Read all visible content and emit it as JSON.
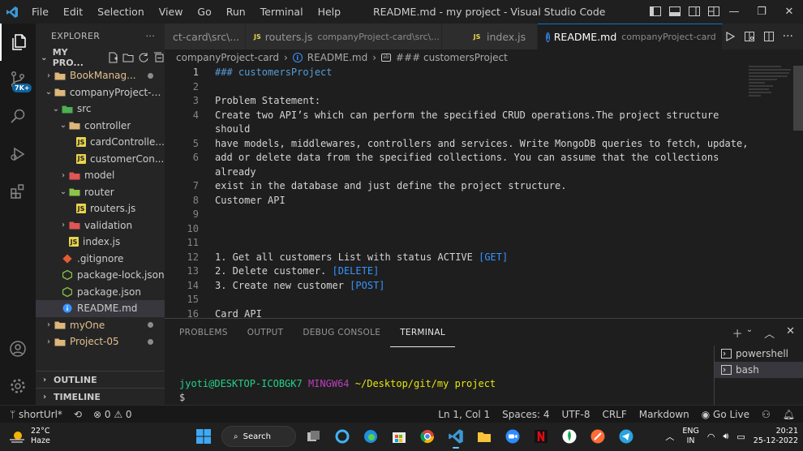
{
  "titlebar": {
    "menus": [
      "File",
      "Edit",
      "Selection",
      "View",
      "Go",
      "Run",
      "Terminal",
      "Help"
    ],
    "title": "README.md - my project - Visual Studio Code"
  },
  "activitybar": {
    "badge": "7K+"
  },
  "sidebar": {
    "header": "EXPLORER",
    "section_title": "MY PRO...",
    "tree": [
      {
        "name": "BookManag...",
        "depth": 1,
        "type": "folder",
        "open": false,
        "color": "#e2c08d",
        "dot": true
      },
      {
        "name": "companyProject-c...",
        "depth": 1,
        "type": "folder",
        "open": true,
        "color": "#cccccc",
        "dot": false
      },
      {
        "name": "src",
        "depth": 2,
        "type": "folder",
        "open": true,
        "color": "#cccccc",
        "dot": false
      },
      {
        "name": "controller",
        "depth": 3,
        "type": "folder",
        "open": true,
        "color": "#cccccc",
        "dot": false
      },
      {
        "name": "cardControlle...",
        "depth": 4,
        "type": "js",
        "color": "#cccccc",
        "dot": false
      },
      {
        "name": "customerCon...",
        "depth": 4,
        "type": "js",
        "color": "#cccccc",
        "dot": false
      },
      {
        "name": "model",
        "depth": 3,
        "type": "folder",
        "open": false,
        "color": "#cccccc",
        "dot": false
      },
      {
        "name": "router",
        "depth": 3,
        "type": "folder",
        "open": true,
        "color": "#cccccc",
        "dot": false
      },
      {
        "name": "routers.js",
        "depth": 4,
        "type": "js",
        "color": "#cccccc",
        "dot": false
      },
      {
        "name": "validation",
        "depth": 3,
        "type": "folder",
        "open": false,
        "color": "#cccccc",
        "dot": false
      },
      {
        "name": "index.js",
        "depth": 3,
        "type": "js",
        "color": "#cccccc",
        "dot": false
      },
      {
        "name": ".gitignore",
        "depth": 2,
        "type": "git",
        "color": "#cccccc",
        "dot": false
      },
      {
        "name": "package-lock.json",
        "depth": 2,
        "type": "json",
        "color": "#cccccc",
        "dot": false
      },
      {
        "name": "package.json",
        "depth": 2,
        "type": "json",
        "color": "#cccccc",
        "dot": false
      },
      {
        "name": "README.md",
        "depth": 2,
        "type": "info",
        "color": "#cccccc",
        "dot": false,
        "selected": true
      },
      {
        "name": "myOne",
        "depth": 1,
        "type": "folder",
        "open": false,
        "color": "#e2c08d",
        "dot": true
      },
      {
        "name": "Project-05",
        "depth": 1,
        "type": "folder",
        "open": false,
        "color": "#e2c08d",
        "dot": true
      }
    ],
    "outline": "OUTLINE",
    "timeline": "TIMELINE"
  },
  "tabs": [
    {
      "label": "ct-card\\src\\...",
      "desc": "",
      "icon": "",
      "active": false
    },
    {
      "label": "routers.js",
      "desc": "companyProject-card\\src\\...",
      "icon": "JS",
      "active": false
    },
    {
      "label": "index.js",
      "desc": "",
      "icon": "JS",
      "active": false
    },
    {
      "label": "README.md",
      "desc": "companyProject-card",
      "icon": "i",
      "active": true
    }
  ],
  "breadcrumb": {
    "folder": "companyProject-card",
    "file": "README.md",
    "symbol": "### customersProject"
  },
  "editor": {
    "lines": [
      {
        "n": "1",
        "text": "### customersProject",
        "kind": "heading"
      },
      {
        "n": "2",
        "text": "",
        "kind": ""
      },
      {
        "n": "3",
        "text": "Problem Statement:",
        "kind": ""
      },
      {
        "n": "4",
        "text": "Create two API’s which can perform the specified CRUD operations.The project structure",
        "kind": ""
      },
      {
        "n": "",
        "text": "should",
        "kind": ""
      },
      {
        "n": "5",
        "text": "have models, middlewares, controllers and services. Write MongoDB queries to fetch, update,",
        "kind": ""
      },
      {
        "n": "6",
        "text": "add or delete data from the specified collections. You can assume that the collections",
        "kind": ""
      },
      {
        "n": "",
        "text": "already",
        "kind": ""
      },
      {
        "n": "7",
        "text": "exist in the database and just define the project structure.",
        "kind": ""
      },
      {
        "n": "8",
        "text": "Customer API",
        "kind": ""
      },
      {
        "n": "9",
        "text": "",
        "kind": ""
      },
      {
        "n": "10",
        "text": "",
        "kind": ""
      },
      {
        "n": "11",
        "text": "",
        "kind": ""
      },
      {
        "n": "12",
        "text": "1. Get all customers List with status ACTIVE ",
        "bracket": "[GET]",
        "kind": ""
      },
      {
        "n": "13",
        "text": "2. Delete customer. ",
        "bracket": "[DELETE]",
        "kind": ""
      },
      {
        "n": "14",
        "text": "3. Create new customer ",
        "bracket": "[POST]",
        "kind": ""
      },
      {
        "n": "15",
        "text": "",
        "kind": ""
      },
      {
        "n": "16",
        "text": "Card API",
        "kind": ""
      }
    ]
  },
  "panel": {
    "tabs": [
      "PROBLEMS",
      "OUTPUT",
      "DEBUG CONSOLE",
      "TERMINAL"
    ],
    "active_tab": "TERMINAL",
    "terminal": {
      "user": "jyoti@DESKTOP-ICOBGK7",
      "host": "MINGW64",
      "path": "~/Desktop/git/my project",
      "prompt": "$"
    },
    "terminals": [
      "powershell",
      "bash"
    ]
  },
  "statusbar": {
    "branch": "shortUrl*",
    "errors": "0",
    "warnings": "0",
    "position": "Ln 1, Col 1",
    "spaces": "Spaces: 4",
    "encoding": "UTF-8",
    "eol": "CRLF",
    "language": "Markdown",
    "golive": "Go Live"
  },
  "taskbar": {
    "temp": "22°C",
    "weather": "Haze",
    "search": "Search",
    "lang1": "ENG",
    "lang2": "IN",
    "time": "20:21",
    "date": "25-12-2022"
  },
  "colors": {
    "accent": "#0078d4",
    "js": "#e8d44d",
    "folder": "#dcb67a"
  }
}
